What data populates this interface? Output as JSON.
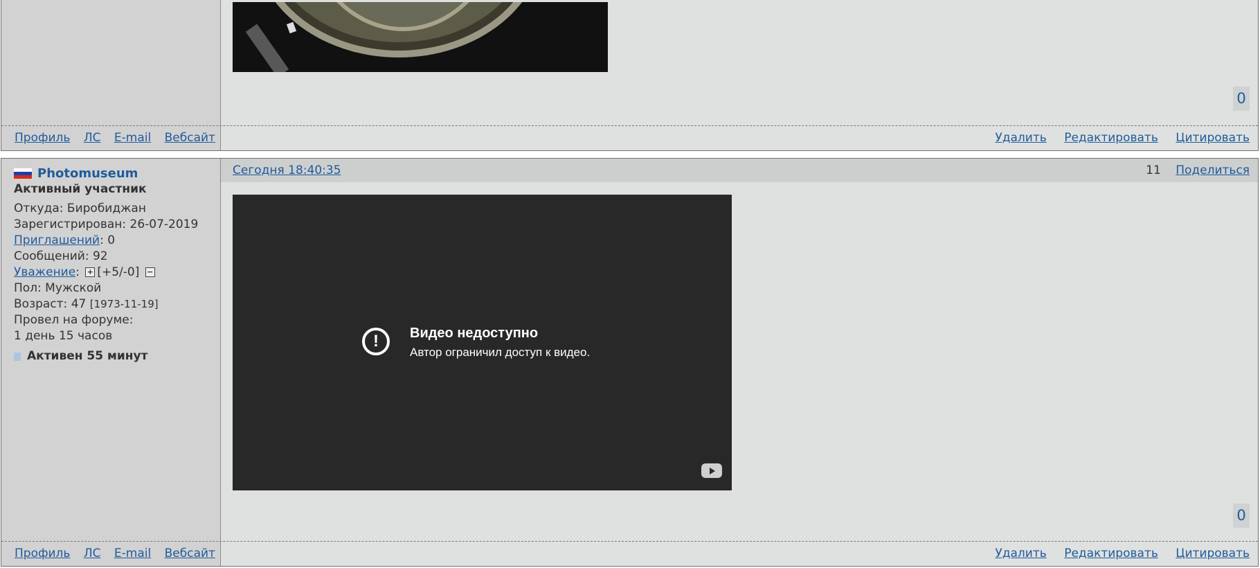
{
  "post1": {
    "rep_value": "0",
    "footer_left": [
      "Профиль",
      "ЛС",
      "E-mail",
      "Вебсайт"
    ],
    "footer_right": [
      "Удалить",
      "Редактировать",
      "Цитировать"
    ]
  },
  "post2": {
    "user": {
      "name": "Photomuseum",
      "title": "Активный участник",
      "from_label": "Откуда: Биробиджан",
      "registered": "Зарегистрирован: 26-07-2019",
      "invites_link": "Приглашений",
      "invites_value": ": 0",
      "messages": "Сообщений: 92",
      "respect_link": "Уважение",
      "respect_colon": ":",
      "respect_plus": "+",
      "respect_value": "[+5/-0]",
      "respect_minus": "−",
      "gender": "Пол: Мужской",
      "age_label": "Возраст: 47",
      "age_date": "[1973-11-19]",
      "forum_time_label": "Провел на форуме:",
      "forum_time_value": "1 день 15 часов",
      "active_status": "Активен 55 минут"
    },
    "header": {
      "date": "Сегодня 18:40:35",
      "post_number": "11",
      "share": "Поделиться"
    },
    "video": {
      "title": "Видео недоступно",
      "subtitle": "Автор ограничил доступ к видео."
    },
    "rep_value": "0",
    "footer_left": [
      "Профиль",
      "ЛС",
      "E-mail",
      "Вебсайт"
    ],
    "footer_right": [
      "Удалить",
      "Редактировать",
      "Цитировать"
    ]
  },
  "colors": {
    "link": "#1f5b9b",
    "post_bg": "#dfe1e0",
    "sidebar_bg": "#d2d2d2",
    "video_bg": "#282828"
  }
}
